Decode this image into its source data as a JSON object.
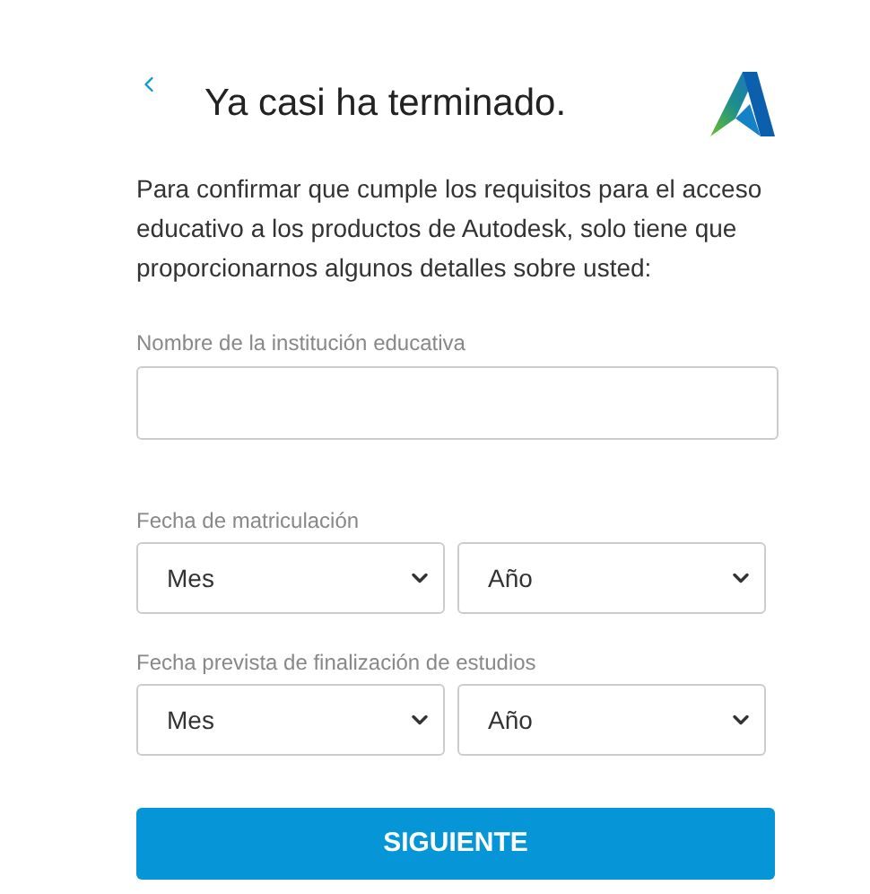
{
  "header": {
    "title": "Ya casi ha terminado."
  },
  "intro": "Para confirmar que cumple los requisitos para el acceso educativo a los productos de Autodesk, solo tiene que proporcionarnos algunos detalles sobre usted:",
  "institution": {
    "label": "Nombre de la institución educativa"
  },
  "date_fields": [
    {
      "label": "Fecha de matriculación",
      "dropdowns": [
        "Mes",
        "Año"
      ]
    },
    {
      "label": "Fecha prevista de finalización de estudios",
      "dropdowns": [
        "Mes",
        "Año"
      ]
    }
  ],
  "next_button": "SIGUIENTE"
}
